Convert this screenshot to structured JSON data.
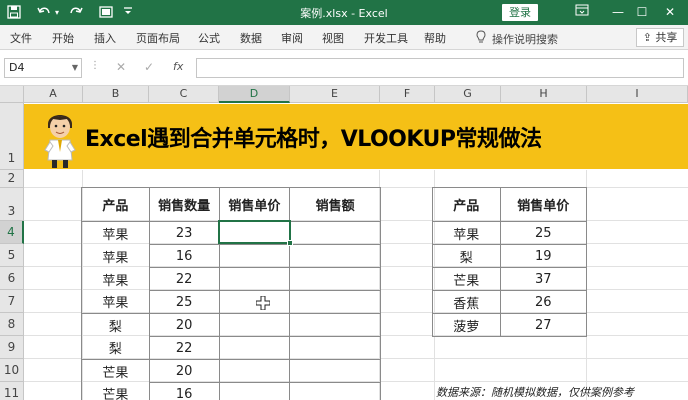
{
  "window": {
    "title": "案例.xlsx - Excel",
    "login_label": "登录",
    "colors": {
      "accent": "#217346",
      "banner": "#f5c016"
    }
  },
  "ribbon": {
    "tabs": [
      "文件",
      "开始",
      "插入",
      "页面布局",
      "公式",
      "数据",
      "审阅",
      "视图",
      "开发工具",
      "帮助"
    ],
    "tell_me": "操作说明搜索",
    "share_label": "共享"
  },
  "formula_bar": {
    "name_box": "D4",
    "fx": "fx",
    "value": ""
  },
  "grid": {
    "columns": [
      "A",
      "B",
      "C",
      "D",
      "E",
      "F",
      "G",
      "H",
      "I"
    ],
    "rows": [
      "1",
      "2",
      "3",
      "4",
      "5",
      "6",
      "7",
      "8",
      "9",
      "10",
      "11"
    ],
    "selected_column": "D",
    "selected_row": "4"
  },
  "banner": {
    "title": "Excel遇到合并单元格时，VLOOKUP常规做法"
  },
  "sales_table": {
    "headers": [
      "产品",
      "销售数量",
      "销售单价",
      "销售额"
    ],
    "rows": [
      [
        "苹果",
        "23",
        "",
        ""
      ],
      [
        "苹果",
        "16",
        "",
        ""
      ],
      [
        "苹果",
        "22",
        "",
        ""
      ],
      [
        "苹果",
        "25",
        "",
        ""
      ],
      [
        "梨",
        "20",
        "",
        ""
      ],
      [
        "梨",
        "22",
        "",
        ""
      ],
      [
        "芒果",
        "20",
        "",
        ""
      ],
      [
        "芒果",
        "16",
        "",
        ""
      ]
    ]
  },
  "price_table": {
    "headers": [
      "产品",
      "销售单价"
    ],
    "rows": [
      [
        "苹果",
        "25"
      ],
      [
        "梨",
        "19"
      ],
      [
        "芒果",
        "37"
      ],
      [
        "香蕉",
        "26"
      ],
      [
        "菠萝",
        "27"
      ]
    ]
  },
  "source": {
    "label": "数据来源：",
    "text": "随机模拟数据，仅供案例参考"
  }
}
